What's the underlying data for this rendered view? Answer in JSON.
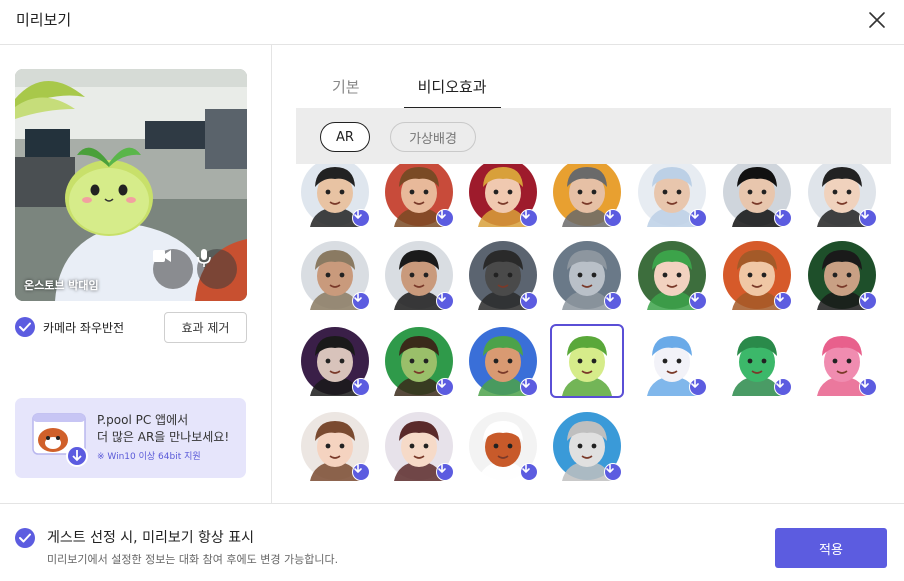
{
  "window": {
    "title": "미리보기"
  },
  "preview": {
    "name_label": "온스토브 박대임"
  },
  "mirror": {
    "label": "카메라 좌우반전",
    "checked": true
  },
  "reset_button": {
    "label": "효과 제거"
  },
  "promo": {
    "line1": "P.pool PC 앱에서",
    "line2": "더 많은 AR을 만나보세요!",
    "line3": "※ Win10 이상 64bit 지원"
  },
  "tabs": [
    {
      "label": "기본",
      "active": false
    },
    {
      "label": "비디오효과",
      "active": true
    }
  ],
  "subtabs": [
    {
      "label": "AR",
      "active": true
    },
    {
      "label": "가상배경",
      "active": false
    }
  ],
  "effects": [
    {
      "name": "man-suit",
      "bg": "#dfe6ee",
      "skin": "#e8c3a3",
      "accent": "#222"
    },
    {
      "name": "leopard-hat",
      "bg": "#c84b3a",
      "skin": "#e8b99a",
      "accent": "#7a4a25"
    },
    {
      "name": "red-headdress",
      "bg": "#9e1b2c",
      "skin": "#f0c9b0",
      "accent": "#d8a03a"
    },
    {
      "name": "beanie-glasses",
      "bg": "#e8a030",
      "skin": "#e6c0a5",
      "accent": "#6a6a6a"
    },
    {
      "name": "ppool-cap-mask",
      "bg": "#e7ecf2",
      "skin": "#e8c6ad",
      "accent": "#bcd0e6"
    },
    {
      "name": "black-mask",
      "bg": "#cfd5dc",
      "skin": "#e8c6ad",
      "accent": "#111"
    },
    {
      "name": "grad-cap",
      "bg": "#dfe4ea",
      "skin": "#f0d2bd",
      "accent": "#222"
    },
    {
      "name": "bucket-hat",
      "bg": "#d9dde2",
      "skin": "#c99a7c",
      "accent": "#8a7a62"
    },
    {
      "name": "black-cap",
      "bg": "#d9dde2",
      "skin": "#c99a7c",
      "accent": "#1a1a1a"
    },
    {
      "name": "gas-mask",
      "bg": "#5b6470",
      "skin": "#4a4a4a",
      "accent": "#2a2a2a"
    },
    {
      "name": "knight-helmet",
      "bg": "#6a7988",
      "skin": "#b9c0c8",
      "accent": "#8d969f"
    },
    {
      "name": "green-hair",
      "bg": "#3d6e3d",
      "skin": "#f2d2c0",
      "accent": "#3ca34a"
    },
    {
      "name": "ginger-glasses",
      "bg": "#d65a2a",
      "skin": "#f0c7a5",
      "accent": "#a45a28"
    },
    {
      "name": "pirate-hat",
      "bg": "#1e4f2a",
      "skin": "#c9a084",
      "accent": "#1a1a1a"
    },
    {
      "name": "vampire",
      "bg": "#3a1f48",
      "skin": "#d8c3bb",
      "accent": "#1a1a1a"
    },
    {
      "name": "witch",
      "bg": "#2f9a4a",
      "skin": "#9abf6a",
      "accent": "#3a2a1a"
    },
    {
      "name": "green-cap",
      "bg": "#3a6fd8",
      "skin": "#d99a72",
      "accent": "#4ca24a"
    },
    {
      "name": "sprout",
      "bg": "#ffffff",
      "skin": "#d6ec8a",
      "accent": "#5aa83a",
      "selected": true
    },
    {
      "name": "white-ghost",
      "bg": "#ffffff",
      "skin": "#f2f2f8",
      "accent": "#6aaae8"
    },
    {
      "name": "green-frog",
      "bg": "#ffffff",
      "skin": "#3cb86a",
      "accent": "#2a8a4a"
    },
    {
      "name": "pink-frog",
      "bg": "#ffffff",
      "skin": "#f08cb0",
      "accent": "#e8608c"
    },
    {
      "name": "cartoon-girl",
      "bg": "#ece6e2",
      "skin": "#f5d3c0",
      "accent": "#7a4a30"
    },
    {
      "name": "anime-girl",
      "bg": "#e7e2ea",
      "skin": "#f6dac8",
      "accent": "#5a2a2a"
    },
    {
      "name": "red-panda",
      "bg": "#f3f3f3",
      "skin": "#c85a2a",
      "accent": "#ffffff"
    },
    {
      "name": "statue",
      "bg": "#3a9ad8",
      "skin": "#e0e0e0",
      "accent": "#bfbfbf"
    }
  ],
  "guest": {
    "line1": "게스트 선정 시, 미리보기 항상 표시",
    "line2": "미리보기에서 설정한 정보는 대화 참여 후에도 변경 가능합니다.",
    "checked": true
  },
  "apply_button": {
    "label": "적용"
  },
  "colors": {
    "accent": "#5c5ce0",
    "promo_bg": "#e6e5fb",
    "subbar_bg": "#ececec"
  }
}
